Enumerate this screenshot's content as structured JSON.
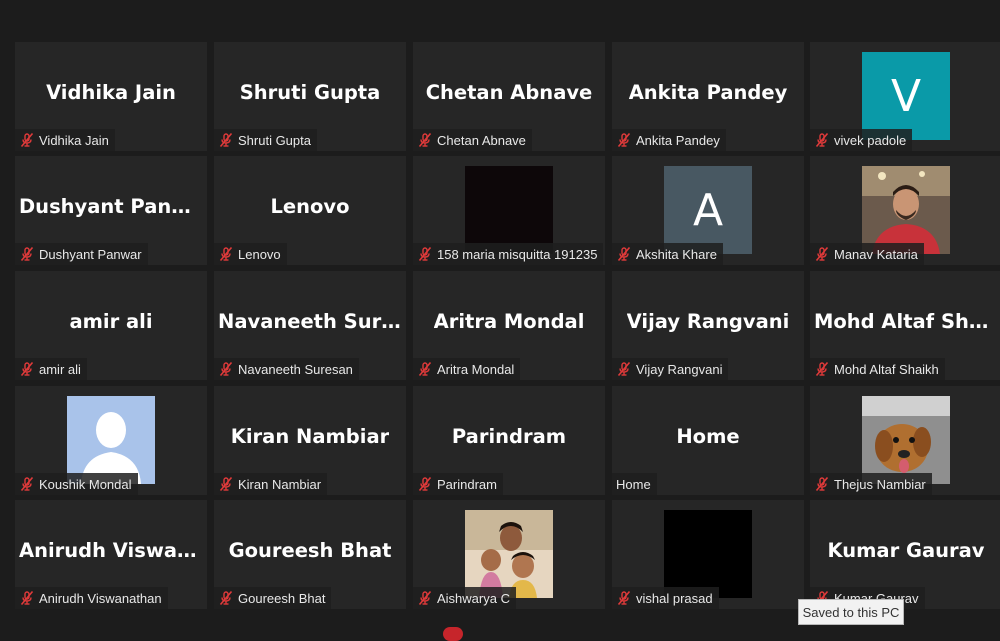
{
  "participants": [
    {
      "display": "Vidhika Jain",
      "label": "Vidhika Jain",
      "muted": true,
      "media": "name"
    },
    {
      "display": "Shruti Gupta",
      "label": "Shruti Gupta",
      "muted": true,
      "media": "name"
    },
    {
      "display": "Chetan Abnave",
      "label": "Chetan Abnave",
      "muted": true,
      "media": "name"
    },
    {
      "display": "Ankita Pandey",
      "label": "Ankita Pandey",
      "muted": true,
      "media": "name"
    },
    {
      "display": "V",
      "label": "vivek padole",
      "muted": true,
      "media": "letter-teal"
    },
    {
      "display": "Dushyant Panwar",
      "label": "Dushyant Panwar",
      "muted": true,
      "media": "name"
    },
    {
      "display": "Lenovo",
      "label": "Lenovo",
      "muted": true,
      "media": "name"
    },
    {
      "display": "",
      "label": "158 maria misquitta 191235",
      "muted": true,
      "media": "video-dark"
    },
    {
      "display": "A",
      "label": "Akshita Khare",
      "muted": true,
      "media": "letter-slate"
    },
    {
      "display": "",
      "label": "Manav Kataria",
      "muted": true,
      "media": "photo-man"
    },
    {
      "display": "amir ali",
      "label": "amir ali",
      "muted": true,
      "media": "name"
    },
    {
      "display": "Navaneeth  Sure...",
      "label": "Navaneeth Suresan",
      "muted": true,
      "media": "name"
    },
    {
      "display": "Aritra Mondal",
      "label": "Aritra Mondal",
      "muted": true,
      "media": "name"
    },
    {
      "display": "Vijay Rangvani",
      "label": "Vijay Rangvani",
      "muted": true,
      "media": "name"
    },
    {
      "display": "Mohd  Altaf  Shai...",
      "label": "Mohd Altaf Shaikh",
      "muted": true,
      "media": "name"
    },
    {
      "display": "",
      "label": "Koushik Mondal",
      "muted": true,
      "media": "photo-default"
    },
    {
      "display": "Kiran Nambiar",
      "label": "Kiran Nambiar",
      "muted": true,
      "media": "name"
    },
    {
      "display": "Parindram",
      "label": "Parindram",
      "muted": true,
      "media": "name"
    },
    {
      "display": "Home",
      "label": "Home",
      "muted": false,
      "media": "name"
    },
    {
      "display": "",
      "label": "Thejus Nambiar",
      "muted": true,
      "media": "photo-dog"
    },
    {
      "display": "Anirudh  Viswan...",
      "label": "Anirudh Viswanathan",
      "muted": true,
      "media": "name"
    },
    {
      "display": "Goureesh Bhat",
      "label": "Goureesh Bhat",
      "muted": true,
      "media": "name"
    },
    {
      "display": "",
      "label": "Aishwarya C",
      "muted": true,
      "media": "photo-family"
    },
    {
      "display": "",
      "label": "vishal prasad",
      "muted": true,
      "media": "video-black"
    },
    {
      "display": "Kumar Gaurav",
      "label": "Kumar Gaurav",
      "muted": true,
      "media": "name"
    }
  ],
  "tooltip": {
    "text": "Saved to this PC"
  },
  "colors": {
    "background": "#1c1c1c",
    "tile": "#262626",
    "mute_red": "#e03a3a",
    "teal_avatar": "#0a9aa8",
    "slate_avatar": "#485862"
  }
}
